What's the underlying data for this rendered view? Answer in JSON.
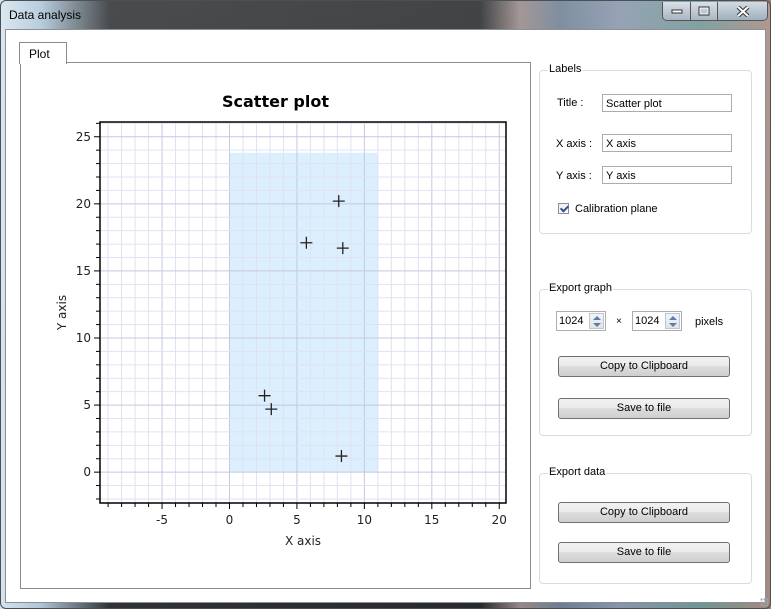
{
  "window": {
    "title": "Data analysis",
    "controls": {
      "minimize": "minimize",
      "maximize": "maximize",
      "close": "close"
    }
  },
  "tabs": [
    {
      "label": "Plot",
      "selected": true
    }
  ],
  "labels_group": {
    "legend": "Labels",
    "title_label": "Title :",
    "title_value": "Scatter plot",
    "xaxis_label": "X axis :",
    "xaxis_value": "X axis",
    "yaxis_label": "Y axis :",
    "yaxis_value": "Y axis",
    "calibration_label": "Calibration plane",
    "calibration_checked": true
  },
  "export_graph": {
    "legend": "Export graph",
    "width_value": "1024",
    "times": "×",
    "height_value": "1024",
    "unit": "pixels",
    "copy_label": "Copy to Clipboard",
    "save_label": "Save to file"
  },
  "export_data": {
    "legend": "Export data",
    "copy_label": "Copy to Clipboard",
    "save_label": "Save to file"
  },
  "chart_data": {
    "type": "scatter",
    "title": "Scatter plot",
    "xlabel": "X axis",
    "ylabel": "Y axis",
    "xlim": [
      -9.6,
      20.5
    ],
    "ylim": [
      -2.3,
      26.1
    ],
    "xticks": [
      -5,
      0,
      5,
      10,
      15,
      20
    ],
    "yticks": [
      0,
      5,
      10,
      15,
      20,
      25
    ],
    "minor_step": 1,
    "grid": true,
    "marker": "plus",
    "calibration_plane": {
      "x": [
        0,
        11
      ],
      "y": [
        0,
        23.8
      ],
      "color": "#dcefff"
    },
    "points": [
      {
        "x": 8.1,
        "y": 20.2
      },
      {
        "x": 5.7,
        "y": 17.1
      },
      {
        "x": 8.4,
        "y": 16.7
      },
      {
        "x": 2.6,
        "y": 5.7
      },
      {
        "x": 3.1,
        "y": 4.7
      },
      {
        "x": 8.3,
        "y": 1.2
      }
    ]
  }
}
